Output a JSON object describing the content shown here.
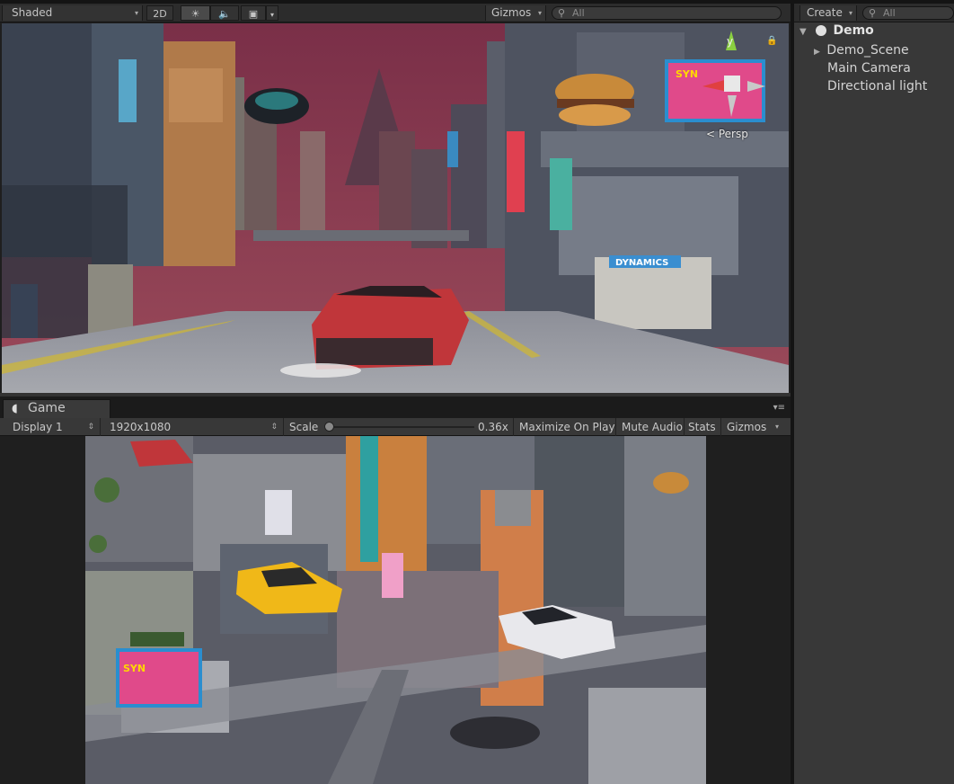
{
  "scene_toolbar": {
    "shading_mode": "Shaded",
    "mode_2d": "2D",
    "gizmos_label": "Gizmos",
    "search_placeholder": "All"
  },
  "scene_view": {
    "projection_label": "< Persp",
    "axis_label": "y",
    "billboard_text": "SYN",
    "sign_text": "DYNAMICS",
    "sky_color": "#8a3b52"
  },
  "hierarchy": {
    "create_label": "Create",
    "search_placeholder": "All",
    "scene_name": "Demo",
    "items": [
      "Demo_Scene",
      "Main Camera",
      "Directional light"
    ]
  },
  "game": {
    "tab_label": "Game",
    "display": "Display 1",
    "resolution": "1920x1080",
    "scale_label": "Scale",
    "scale_value": "0.36x",
    "scale_fraction": 0.36,
    "maximize_on_play": "Maximize On Play",
    "mute_audio": "Mute Audio",
    "stats": "Stats",
    "gizmos": "Gizmos",
    "billboard_text": "SYN"
  }
}
